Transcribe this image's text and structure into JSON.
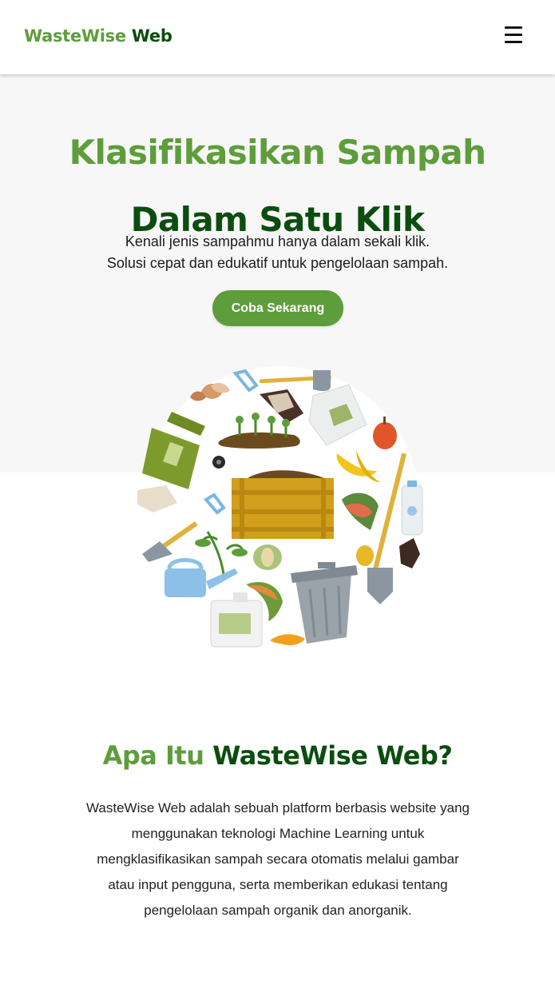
{
  "header": {
    "brand_part1": "WasteWise",
    "brand_part2": "Web",
    "menu_icon": "hamburger-menu-icon"
  },
  "hero": {
    "title_line1": "Klasifikasikan Sampah",
    "title_line2": "Dalam Satu Klik",
    "subtitle_line1": "Kenali jenis sampahmu hanya dalam sekali klik.",
    "subtitle_line2": "Solusi cepat dan edukatif untuk pengelolaan sampah.",
    "cta_label": "Coba Sekarang"
  },
  "about": {
    "title_part1": "Apa Itu",
    "title_part2": "WasteWise Web?",
    "lines": [
      "WasteWise Web adalah sebuah platform berbasis website yang",
      "menggunakan teknologi Machine Learning untuk",
      "mengklasifikasikan sampah secara otomatis melalui gambar",
      "atau input pengguna, serta memberikan edukasi tentang",
      "pengelolaan sampah organik dan anorganik."
    ]
  },
  "colors": {
    "brand_light": "#5e9d3b",
    "brand_dark": "#0b4d0f",
    "hero_background": "#f7f7f7"
  }
}
